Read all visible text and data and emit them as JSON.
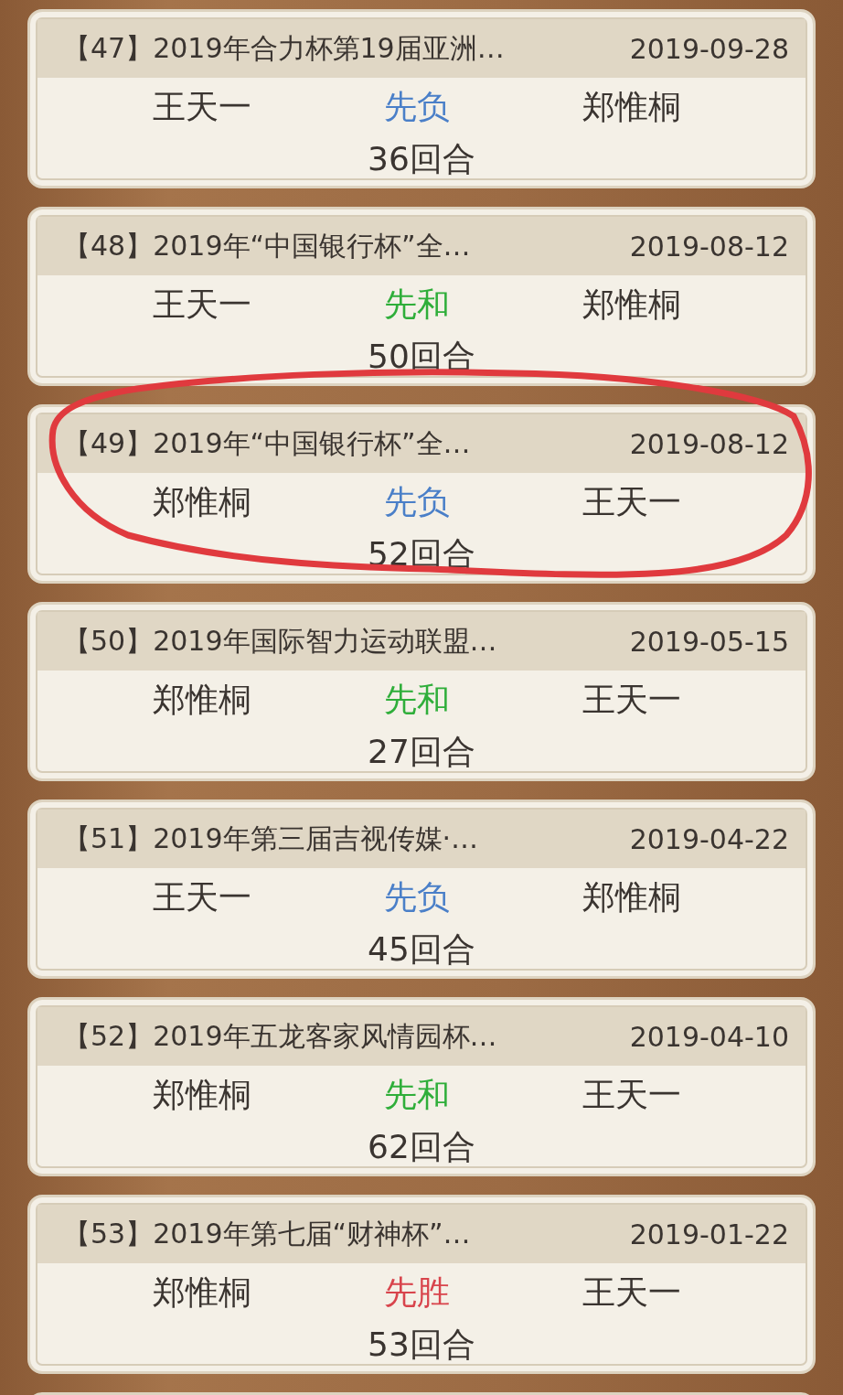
{
  "games": [
    {
      "title": "【47】2019年合力杯第19届亚洲…",
      "date": "2019-09-28",
      "red": "王天一",
      "result": "先负",
      "kind": "loss",
      "black": "郑惟桐",
      "rounds": "36回合"
    },
    {
      "title": "【48】2019年“中国银行杯”全…",
      "date": "2019-08-12",
      "red": "王天一",
      "result": "先和",
      "kind": "draw",
      "black": "郑惟桐",
      "rounds": "50回合"
    },
    {
      "title": "【49】2019年“中国银行杯”全…",
      "date": "2019-08-12",
      "red": "郑惟桐",
      "result": "先负",
      "kind": "loss",
      "black": "王天一",
      "rounds": "52回合"
    },
    {
      "title": "【50】2019年国际智力运动联盟…",
      "date": "2019-05-15",
      "red": "郑惟桐",
      "result": "先和",
      "kind": "draw",
      "black": "王天一",
      "rounds": "27回合"
    },
    {
      "title": "【51】2019年第三届吉视传媒·…",
      "date": "2019-04-22",
      "red": "王天一",
      "result": "先负",
      "kind": "loss",
      "black": "郑惟桐",
      "rounds": "45回合"
    },
    {
      "title": "【52】2019年五龙客家风情园杯…",
      "date": "2019-04-10",
      "red": "郑惟桐",
      "result": "先和",
      "kind": "draw",
      "black": "王天一",
      "rounds": "62回合"
    },
    {
      "title": "【53】2019年第七届“财神杯”…",
      "date": "2019-01-22",
      "red": "郑惟桐",
      "result": "先胜",
      "kind": "win",
      "black": "王天一",
      "rounds": "53回合"
    }
  ]
}
